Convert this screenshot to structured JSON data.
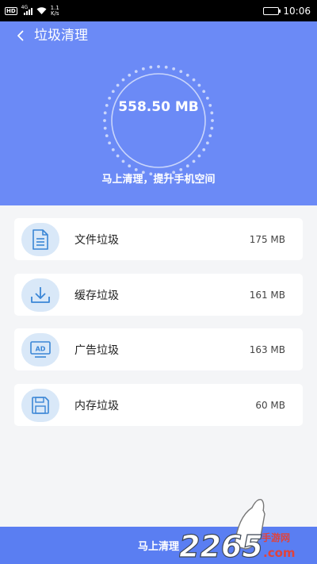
{
  "status_bar": {
    "hd": "HD",
    "signal_tag": "4G",
    "speed_value": "1.1",
    "speed_unit": "K/s",
    "time": "10:06"
  },
  "header": {
    "title": "垃圾清理",
    "total_size": "558.50 MB",
    "subtitle": "马上清理，提升手机空间"
  },
  "items": [
    {
      "label": "文件垃圾",
      "size": "175 MB",
      "icon": "document-icon"
    },
    {
      "label": "缓存垃圾",
      "size": "161 MB",
      "icon": "download-icon"
    },
    {
      "label": "广告垃圾",
      "size": "163 MB",
      "icon": "ad-monitor-icon"
    },
    {
      "label": "内存垃圾",
      "size": "60 MB",
      "icon": "save-disk-icon"
    }
  ],
  "clean_button": "马上清理",
  "watermark": {
    "number": "2265",
    "text": "手游网",
    "site": ".com"
  },
  "colors": {
    "header_bg": "#6b8af6",
    "button_bg": "#5a7ef2",
    "icon_bg": "#d9e8f8",
    "icon_stroke": "#3a86d6"
  }
}
